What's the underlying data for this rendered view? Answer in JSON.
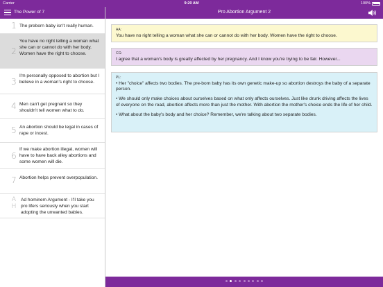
{
  "status_bar": {
    "carrier": "Carrier",
    "time": "9:20 AM",
    "battery": "100%"
  },
  "sidebar": {
    "title": "The Power of 7",
    "items": [
      {
        "number": "1",
        "text": "The preborn baby isn't really human."
      },
      {
        "number": "2",
        "text": "You have no right telling a woman what she can or cannot do with her body. Women have the right to choose.",
        "selected": true
      },
      {
        "number": "3",
        "text": "I'm personally opposed to abortion but I believe in a woman's right to choose."
      },
      {
        "number": "4",
        "text": "Men can't get pregnant so they shouldn't tell women what to do."
      },
      {
        "number": "5",
        "text": "An abortion should be legal in cases of rape or incest."
      },
      {
        "number": "6",
        "text": "If we make abortion illegal, women will have to have back alley abortions and some women will die."
      },
      {
        "number": "7",
        "text": "Abortion helps prevent overpopulation."
      },
      {
        "number": "A H",
        "text": "Ad hominem Argument - I'll take you pro lifers seriously when you start adopting the unwanted babies."
      }
    ]
  },
  "main": {
    "title": "Pro Abortion Argument 2",
    "cards": [
      {
        "speaker": "AA:",
        "paragraphs": [
          "You have no right telling a woman what she can or cannot do with her body. Women have the right to choose."
        ]
      },
      {
        "speaker": "CG:",
        "paragraphs": [
          "I agree that a woman's body is greatly affected by her pregnancy. And I know you're trying to be fair. However..."
        ]
      },
      {
        "speaker": "PL:",
        "paragraphs": [
          "•  Her \"choice\" affects two bodies. The pre-born baby has its own genetic make-up so abortion destroys the baby of a separate person.",
          "•  We should only make choices about ourselves based on what only affects ourselves.  Just like drunk driving affects the lives of everyone on the road, abortion affects more than just the mother.  With abortion the mother's choice ends the life of her child.",
          "•  What about the baby's body and her choice?  Remember, we're talking about two separate bodies."
        ]
      }
    ]
  },
  "pager": {
    "count": 9,
    "active_index": 1
  },
  "colors": {
    "brand": "#7d2a9b",
    "aa_bg": "#fcf8cf",
    "cg_bg": "#ead7f0",
    "pl_bg": "#d9f1f8",
    "selected_row": "#dcdcdc"
  },
  "icons": {
    "menu": "hamburger-menu-icon",
    "sound": "speaker-icon"
  }
}
